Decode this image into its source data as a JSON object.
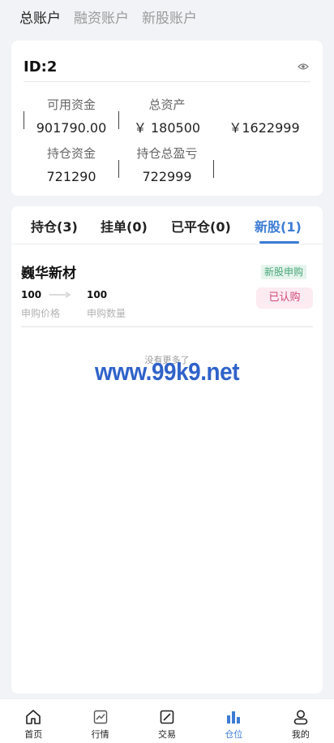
{
  "account_tabs": [
    {
      "label": "总账户",
      "active": true
    },
    {
      "label": "融资账户",
      "active": false
    },
    {
      "label": "新股账户",
      "active": false
    }
  ],
  "account": {
    "id_label": "ID:2",
    "stats": {
      "available_funds": {
        "label": "可用资金",
        "value": "901790.00"
      },
      "total_assets": {
        "label": "总资产",
        "value": "￥ 180500"
      },
      "third_value": "￥1622999",
      "position_funds": {
        "label": "持仓资金",
        "value": "721290"
      },
      "position_pnl": {
        "label": "持仓总盈亏",
        "value": "722999"
      }
    }
  },
  "position_tabs": [
    {
      "label": "持仓(3)",
      "active": false
    },
    {
      "label": "挂单(0)",
      "active": false
    },
    {
      "label": "已平仓(0)",
      "active": false
    },
    {
      "label": "新股(1)",
      "active": true
    }
  ],
  "ipo_item": {
    "name": "巍华新材",
    "type_badge": "新股申购",
    "status_badge": "已认购",
    "price_value": "100",
    "price_label": "申购价格",
    "qty_value": "100",
    "qty_label": "申购数量"
  },
  "no_more_text": "没有更多了",
  "watermark": "www.99k9.net",
  "bottom_nav": [
    {
      "label": "首页",
      "icon": "home-icon",
      "active": false
    },
    {
      "label": "行情",
      "icon": "chart-icon",
      "active": false
    },
    {
      "label": "交易",
      "icon": "trade-icon",
      "active": false
    },
    {
      "label": "仓位",
      "icon": "bar-chart-icon",
      "active": true
    },
    {
      "label": "我的",
      "icon": "user-icon",
      "active": false
    }
  ],
  "colors": {
    "accent": "#3c7cd4",
    "page_bg": "#f2f3f7",
    "ipo_badge_text": "#4aa77a",
    "subscribed_text": "#d3487a"
  }
}
